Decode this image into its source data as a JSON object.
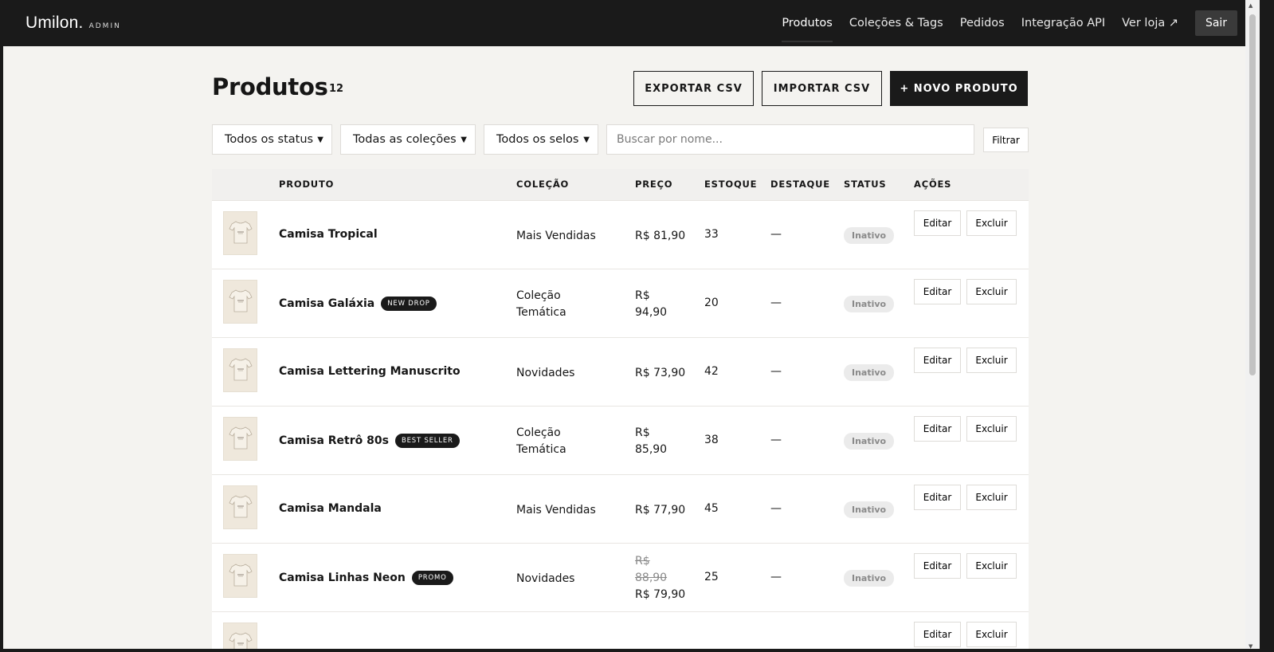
{
  "header": {
    "logo": "Umilon.",
    "logo_sub": "ADMIN",
    "nav": [
      "Produtos",
      "Coleções & Tags",
      "Pedidos",
      "Integração API",
      "Ver loja ↗"
    ],
    "logout": "Sair"
  },
  "page": {
    "title": "Produtos",
    "count": "12",
    "export_label": "EXPORTAR CSV",
    "import_label": "IMPORTAR CSV",
    "new_label": "+ NOVO PRODUTO"
  },
  "filters": {
    "status": "Todos os status",
    "collections": "Todas as coleções",
    "seals": "Todos os selos",
    "search_placeholder": "Buscar por nome...",
    "filter_button": "Filtrar"
  },
  "table": {
    "columns": [
      "PRODUTO",
      "COLEÇÃO",
      "PREÇO",
      "ESTOQUE",
      "DESTAQUE",
      "STATUS",
      "AÇÕES"
    ],
    "edit_label": "Editar",
    "delete_label": "Excluir",
    "rows": [
      {
        "name": "Camisa Tropical",
        "badge": "",
        "collection": [
          "Mais Vendidas"
        ],
        "price_old": [],
        "price": [
          "R$ 81,90"
        ],
        "stock": "33",
        "featured": "—",
        "status": "Inativo"
      },
      {
        "name": "Camisa Galáxia",
        "badge": "NEW DROP",
        "collection": [
          "Coleção",
          "Temática"
        ],
        "price_old": [],
        "price": [
          "R$",
          "94,90"
        ],
        "stock": "20",
        "featured": "—",
        "status": "Inativo"
      },
      {
        "name": "Camisa Lettering Manuscrito",
        "badge": "",
        "collection": [
          "Novidades"
        ],
        "price_old": [],
        "price": [
          "R$ 73,90"
        ],
        "stock": "42",
        "featured": "—",
        "status": "Inativo"
      },
      {
        "name": "Camisa Retrô 80s",
        "badge": "BEST SELLER",
        "collection": [
          "Coleção",
          "Temática"
        ],
        "price_old": [],
        "price": [
          "R$",
          "85,90"
        ],
        "stock": "38",
        "featured": "—",
        "status": "Inativo"
      },
      {
        "name": "Camisa Mandala",
        "badge": "",
        "collection": [
          "Mais Vendidas"
        ],
        "price_old": [],
        "price": [
          "R$ 77,90"
        ],
        "stock": "45",
        "featured": "—",
        "status": "Inativo"
      },
      {
        "name": "Camisa Linhas Neon",
        "badge": "PROMO",
        "collection": [
          "Novidades"
        ],
        "price_old": [
          "R$",
          "88,90"
        ],
        "price": [
          "R$ 79,90"
        ],
        "stock": "25",
        "featured": "—",
        "status": "Inativo"
      }
    ]
  },
  "colors": {
    "topbar": "#1a1a1a",
    "background": "#f4f3f0",
    "accent": "#1a1a1a",
    "thumb": "#efe8dc"
  }
}
